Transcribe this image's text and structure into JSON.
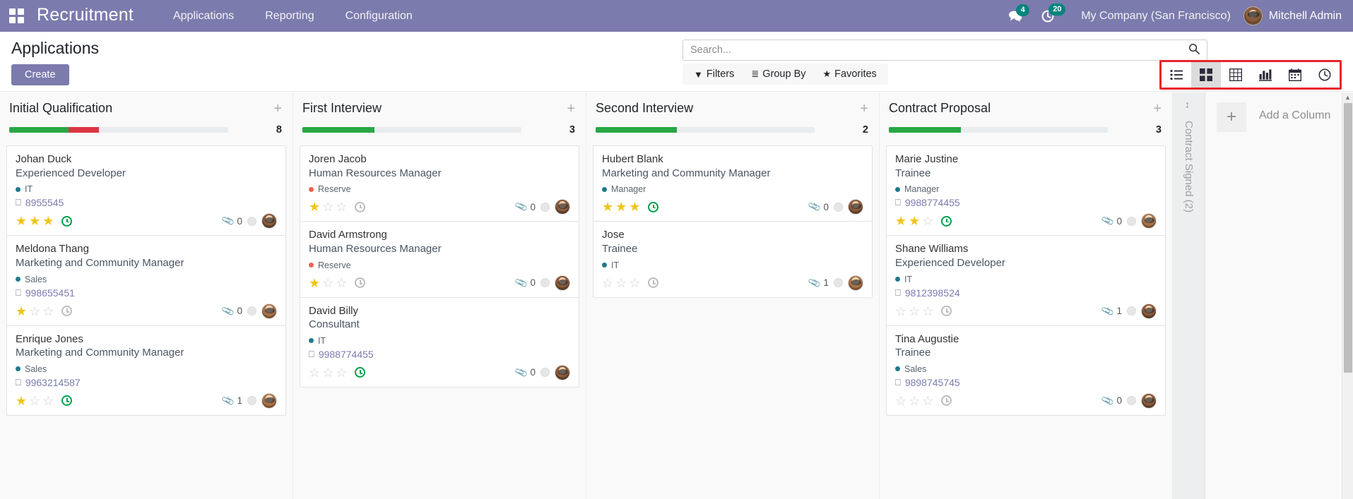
{
  "navbar": {
    "apps_icon": "apps-grid-icon",
    "brand": "Recruitment",
    "menu": [
      {
        "label": "Applications"
      },
      {
        "label": "Reporting"
      },
      {
        "label": "Configuration"
      }
    ],
    "messages_badge": "4",
    "activities_badge": "20",
    "company": "My Company (San Francisco)",
    "user": "Mitchell Admin",
    "bg_color": "#7c7bad"
  },
  "control_panel": {
    "page_title": "Applications",
    "create_label": "Create",
    "search": {
      "value": "",
      "placeholder": "Search..."
    },
    "filters": [
      {
        "label": "Filters",
        "icon": "funnel-icon"
      },
      {
        "label": "Group By",
        "icon": "list-lines-icon"
      },
      {
        "label": "Favorites",
        "icon": "star-icon"
      }
    ],
    "view_switcher": {
      "highlight_color": "#e8262b",
      "active": "kanban",
      "views": [
        {
          "name": "list",
          "label": "List"
        },
        {
          "name": "kanban",
          "label": "Kanban"
        },
        {
          "name": "pivot",
          "label": "Pivot"
        },
        {
          "name": "graph",
          "label": "Graph"
        },
        {
          "name": "calendar",
          "label": "Calendar"
        },
        {
          "name": "activity",
          "label": "Activity"
        }
      ]
    }
  },
  "kanban": {
    "columns": [
      {
        "title": "Initial Qualification",
        "count": "8",
        "progress": [
          {
            "color": "#28a745",
            "pct": 27
          },
          {
            "color": "#dc3545",
            "pct": 14
          }
        ],
        "cards": [
          {
            "name": "Johan Duck",
            "role": "Experienced Developer",
            "tag": "IT",
            "tag_color": "#1f7a8c",
            "phone": "8955545",
            "stars": 3,
            "clock": "green",
            "attachments": "0",
            "avatar": "m"
          },
          {
            "name": "Meldona Thang",
            "role": "Marketing and Community Manager",
            "tag": "Sales",
            "tag_color": "#1f7a8c",
            "phone": "998655451",
            "stars": 1,
            "clock": "grey",
            "attachments": "0",
            "avatar": "f"
          },
          {
            "name": "Enrique Jones",
            "role": "Marketing and Community Manager",
            "tag": "Sales",
            "tag_color": "#1f7a8c",
            "phone": "9963214587",
            "stars": 1,
            "clock": "green",
            "attachments": "1",
            "avatar": "f"
          }
        ]
      },
      {
        "title": "First Interview",
        "count": "3",
        "progress": [
          {
            "color": "#28a745",
            "pct": 33
          }
        ],
        "cards": [
          {
            "name": "Joren Jacob",
            "role": "Human Resources Manager",
            "tag": "Reserve",
            "tag_color": "#f0624d",
            "phone": "",
            "stars": 1,
            "clock": "grey",
            "attachments": "0",
            "avatar": "m"
          },
          {
            "name": "David Armstrong",
            "role": "Human Resources Manager",
            "tag": "Reserve",
            "tag_color": "#f0624d",
            "phone": "",
            "stars": 1,
            "clock": "grey",
            "attachments": "0",
            "avatar": "m"
          },
          {
            "name": "David Billy",
            "role": "Consultant",
            "tag": "IT",
            "tag_color": "#1f7a8c",
            "phone": "9988774455",
            "stars": 0,
            "clock": "green",
            "attachments": "0",
            "avatar": "m"
          }
        ]
      },
      {
        "title": "Second Interview",
        "count": "2",
        "progress": [
          {
            "color": "#28a745",
            "pct": 37
          }
        ],
        "cards": [
          {
            "name": "Hubert Blank",
            "role": "Marketing and Community Manager",
            "tag": "Manager",
            "tag_color": "#1f7a8c",
            "phone": "",
            "stars": 3,
            "clock": "green",
            "attachments": "0",
            "avatar": "m"
          },
          {
            "name": "Jose",
            "role": "Trainee",
            "tag": "IT",
            "tag_color": "#1f7a8c",
            "phone": "",
            "stars": 0,
            "clock": "grey",
            "attachments": "1",
            "avatar": "f"
          }
        ]
      },
      {
        "title": "Contract Proposal",
        "count": "3",
        "progress": [
          {
            "color": "#28a745",
            "pct": 33
          }
        ],
        "cards": [
          {
            "name": "Marie Justine",
            "role": "Trainee",
            "tag": "Manager",
            "tag_color": "#1f7a8c",
            "phone": "9988774455",
            "stars": 2,
            "clock": "green",
            "attachments": "0",
            "avatar": "f"
          },
          {
            "name": "Shane Williams",
            "role": "Experienced Developer",
            "tag": "IT",
            "tag_color": "#1f7a8c",
            "phone": "9812398524",
            "stars": 0,
            "clock": "grey",
            "attachments": "1",
            "avatar": "m"
          },
          {
            "name": "Tina Augustie",
            "role": "Trainee",
            "tag": "Sales",
            "tag_color": "#1f7a8c",
            "phone": "9898745745",
            "stars": 0,
            "clock": "grey",
            "attachments": "0",
            "avatar": "m"
          }
        ]
      }
    ],
    "collapsed_column": {
      "label": "Contract Signed (2)"
    },
    "add_column": {
      "label": "Add a Column",
      "plus": "+"
    }
  }
}
